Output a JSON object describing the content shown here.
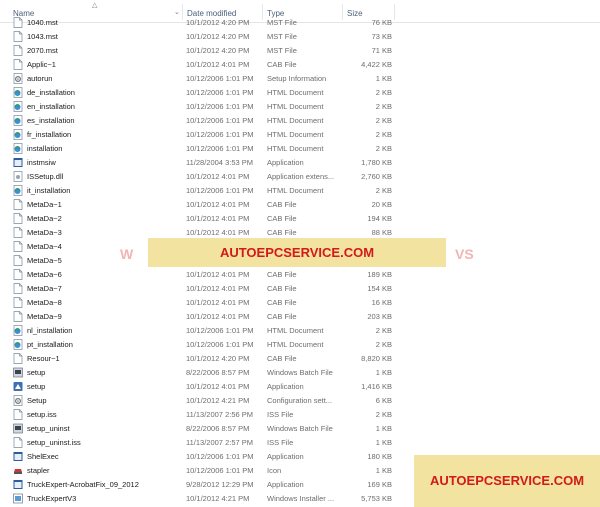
{
  "columns": {
    "name": "Name",
    "date": "Date modified",
    "type": "Type",
    "size": "Size"
  },
  "rows": [
    {
      "name": "1040.mst",
      "date": "10/1/2012 4:20 PM",
      "type": "MST File",
      "size": "76 KB",
      "icon": "doc-icon"
    },
    {
      "name": "1043.mst",
      "date": "10/1/2012 4:20 PM",
      "type": "MST File",
      "size": "73 KB",
      "icon": "doc-icon"
    },
    {
      "name": "2070.mst",
      "date": "10/1/2012 4:20 PM",
      "type": "MST File",
      "size": "71 KB",
      "icon": "doc-icon"
    },
    {
      "name": "Applic~1",
      "date": "10/1/2012 4:01 PM",
      "type": "CAB File",
      "size": "4,422 KB",
      "icon": "doc-icon"
    },
    {
      "name": "autorun",
      "date": "10/12/2006 1:01 PM",
      "type": "Setup Information",
      "size": "1 KB",
      "icon": "gear-icon"
    },
    {
      "name": "de_installation",
      "date": "10/12/2006 1:01 PM",
      "type": "HTML Document",
      "size": "2 KB",
      "icon": "html-icon"
    },
    {
      "name": "en_installation",
      "date": "10/12/2006 1:01 PM",
      "type": "HTML Document",
      "size": "2 KB",
      "icon": "html-icon"
    },
    {
      "name": "es_installation",
      "date": "10/12/2006 1:01 PM",
      "type": "HTML Document",
      "size": "2 KB",
      "icon": "html-icon"
    },
    {
      "name": "fr_installation",
      "date": "10/12/2006 1:01 PM",
      "type": "HTML Document",
      "size": "2 KB",
      "icon": "html-icon"
    },
    {
      "name": "installation",
      "date": "10/12/2006 1:01 PM",
      "type": "HTML Document",
      "size": "2 KB",
      "icon": "html-icon"
    },
    {
      "name": "instmsiw",
      "date": "11/28/2004 3:53 PM",
      "type": "Application",
      "size": "1,780 KB",
      "icon": "app-icon"
    },
    {
      "name": "ISSetup.dll",
      "date": "10/1/2012 4:01 PM",
      "type": "Application extens...",
      "size": "2,760 KB",
      "icon": "dll-icon"
    },
    {
      "name": "it_installation",
      "date": "10/12/2006 1:01 PM",
      "type": "HTML Document",
      "size": "2 KB",
      "icon": "html-icon"
    },
    {
      "name": "MetaDa~1",
      "date": "10/1/2012 4:01 PM",
      "type": "CAB File",
      "size": "20 KB",
      "icon": "doc-icon"
    },
    {
      "name": "MetaDa~2",
      "date": "10/1/2012 4:01 PM",
      "type": "CAB File",
      "size": "194 KB",
      "icon": "doc-icon"
    },
    {
      "name": "MetaDa~3",
      "date": "10/1/2012 4:01 PM",
      "type": "CAB File",
      "size": "88 KB",
      "icon": "doc-icon"
    },
    {
      "name": "MetaDa~4",
      "date": "",
      "type": "",
      "size": "",
      "icon": "doc-icon"
    },
    {
      "name": "MetaDa~5",
      "date": "",
      "type": "",
      "size": "",
      "icon": "doc-icon"
    },
    {
      "name": "MetaDa~6",
      "date": "10/1/2012 4:01 PM",
      "type": "CAB File",
      "size": "189 KB",
      "icon": "doc-icon"
    },
    {
      "name": "MetaDa~7",
      "date": "10/1/2012 4:01 PM",
      "type": "CAB File",
      "size": "154 KB",
      "icon": "doc-icon"
    },
    {
      "name": "MetaDa~8",
      "date": "10/1/2012 4:01 PM",
      "type": "CAB File",
      "size": "16 KB",
      "icon": "doc-icon"
    },
    {
      "name": "MetaDa~9",
      "date": "10/1/2012 4:01 PM",
      "type": "CAB File",
      "size": "203 KB",
      "icon": "doc-icon"
    },
    {
      "name": "nl_installation",
      "date": "10/12/2006 1:01 PM",
      "type": "HTML Document",
      "size": "2 KB",
      "icon": "html-icon"
    },
    {
      "name": "pt_installation",
      "date": "10/12/2006 1:01 PM",
      "type": "HTML Document",
      "size": "2 KB",
      "icon": "html-icon"
    },
    {
      "name": "Resour~1",
      "date": "10/1/2012 4:20 PM",
      "type": "CAB File",
      "size": "8,820 KB",
      "icon": "doc-icon"
    },
    {
      "name": "setup",
      "date": "8/22/2006 8:57 PM",
      "type": "Windows Batch File",
      "size": "1 KB",
      "icon": "batch-icon"
    },
    {
      "name": "setup",
      "date": "10/1/2012 4:01 PM",
      "type": "Application",
      "size": "1,416 KB",
      "icon": "setup-icon"
    },
    {
      "name": "Setup",
      "date": "10/1/2012 4:21 PM",
      "type": "Configuration sett...",
      "size": "6 KB",
      "icon": "gear-icon"
    },
    {
      "name": "setup.iss",
      "date": "11/13/2007 2:56 PM",
      "type": "ISS File",
      "size": "2 KB",
      "icon": "doc-icon"
    },
    {
      "name": "setup_uninst",
      "date": "8/22/2006 8:57 PM",
      "type": "Windows Batch File",
      "size": "1 KB",
      "icon": "batch-icon"
    },
    {
      "name": "setup_uninst.iss",
      "date": "11/13/2007 2:57 PM",
      "type": "ISS File",
      "size": "1 KB",
      "icon": "doc-icon"
    },
    {
      "name": "ShelExec",
      "date": "10/12/2006 1:01 PM",
      "type": "Application",
      "size": "180 KB",
      "icon": "app-icon"
    },
    {
      "name": "stapler",
      "date": "10/12/2006 1:01 PM",
      "type": "Icon",
      "size": "1 KB",
      "icon": "stapler-icon"
    },
    {
      "name": "TruckExpert-AcrobatFix_09_2012",
      "date": "9/28/2012 12:29 PM",
      "type": "Application",
      "size": "169 KB",
      "icon": "app-icon"
    },
    {
      "name": "TruckExpertV3",
      "date": "10/1/2012 4:21 PM",
      "type": "Windows Installer ...",
      "size": "5,753 KB",
      "icon": "msi-icon"
    }
  ],
  "watermarks": {
    "center": "AUTOEPCSERVICE.COM",
    "corner": "AUTOEPCSERVICE.COM"
  }
}
